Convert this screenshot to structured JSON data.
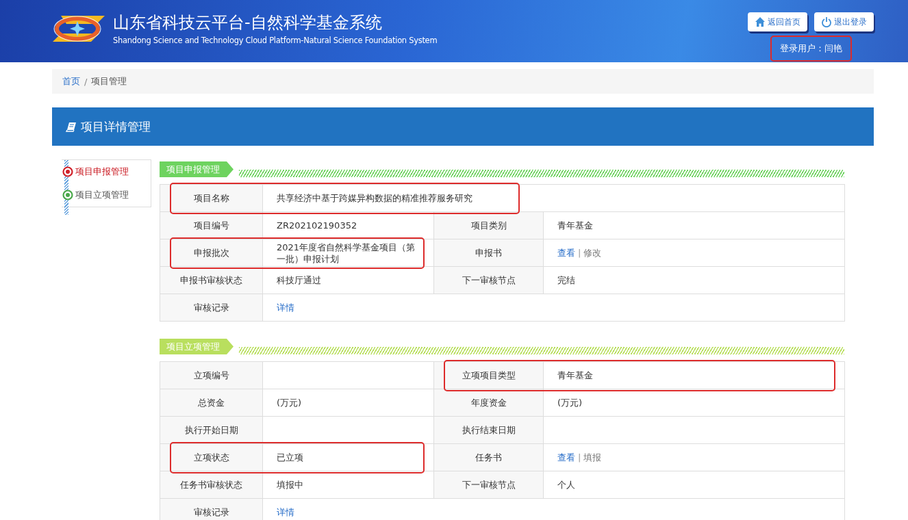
{
  "header": {
    "title": "山东省科技云平台-自然科学基金系统",
    "subtitle": "Shandong Science and Technology Cloud Platform-Natural Science Foundation System",
    "buttons": [
      {
        "label": "返回首页",
        "kind": "home"
      },
      {
        "label": "退出登录",
        "kind": "logout"
      }
    ],
    "login_user": {
      "text": "登录用户：闫艳",
      "highlighted": true
    }
  },
  "breadcrumb": [
    {
      "label": "首页",
      "kind": "link"
    },
    {
      "label": "/",
      "kind": "separator"
    },
    {
      "label": "项目管理",
      "kind": "current"
    }
  ],
  "panel_title": "项目详情管理",
  "sidebar": {
    "items": [
      {
        "label": "项目申报管理",
        "selected": true
      },
      {
        "label": "项目立项管理",
        "selected": false
      }
    ]
  },
  "sections": [
    {
      "tag": "项目申报管理",
      "color": "#6ed35f",
      "rows": [
        [
          {
            "label": "项目名称",
            "value": "共享经济中基于跨媒异构数据的精准推荐服务研究",
            "highlighted": true
          }
        ],
        [
          {
            "label": "项目编号",
            "value": "ZR202102190352",
            "highlighted": false
          },
          {
            "label": "项目类别",
            "value": "青年基金",
            "highlighted": false
          }
        ],
        [
          {
            "label": "申报批次",
            "value": "2021年度省自然科学基金项目（第一批）申报计划",
            "highlighted": true
          },
          {
            "label": "申报书",
            "links": [
              {
                "text": "查看",
                "kind": "link"
              },
              {
                "text": "|",
                "kind": "separator"
              },
              {
                "text": "修改",
                "kind": "muted"
              }
            ],
            "highlighted": false
          }
        ],
        [
          {
            "label": "申报书审核状态",
            "value": "科技厅通过",
            "highlighted": false
          },
          {
            "label": "下一审核节点",
            "value": "完结",
            "highlighted": false
          }
        ],
        [
          {
            "label": "审核记录",
            "links": [
              {
                "text": "详情",
                "kind": "link"
              }
            ],
            "highlighted": false
          }
        ]
      ]
    },
    {
      "tag": "项目立项管理",
      "color": "#b9df5e",
      "rows": [
        [
          {
            "label": "立项编号",
            "highlighted": false
          },
          {
            "label": "立项项目类型",
            "value": "青年基金",
            "highlighted": true
          }
        ],
        [
          {
            "label": "总资金",
            "value": "(万元)",
            "highlighted": false
          },
          {
            "label": "年度资金",
            "value": "(万元)",
            "highlighted": false
          }
        ],
        [
          {
            "label": "执行开始日期",
            "highlighted": false
          },
          {
            "label": "执行结束日期",
            "highlighted": false
          }
        ],
        [
          {
            "label": "立项状态",
            "value": "已立项",
            "highlighted": true
          },
          {
            "label": "任务书",
            "links": [
              {
                "text": "查看",
                "kind": "link"
              },
              {
                "text": "|",
                "kind": "separator"
              },
              {
                "text": "填报",
                "kind": "muted"
              }
            ],
            "highlighted": false
          }
        ],
        [
          {
            "label": "任务书审核状态",
            "value": "填报中",
            "highlighted": false
          },
          {
            "label": "下一审核节点",
            "value": "个人",
            "highlighted": false
          }
        ],
        [
          {
            "label": "审核记录",
            "links": [
              {
                "text": "详情",
                "kind": "link"
              }
            ],
            "highlighted": false
          }
        ]
      ]
    }
  ]
}
